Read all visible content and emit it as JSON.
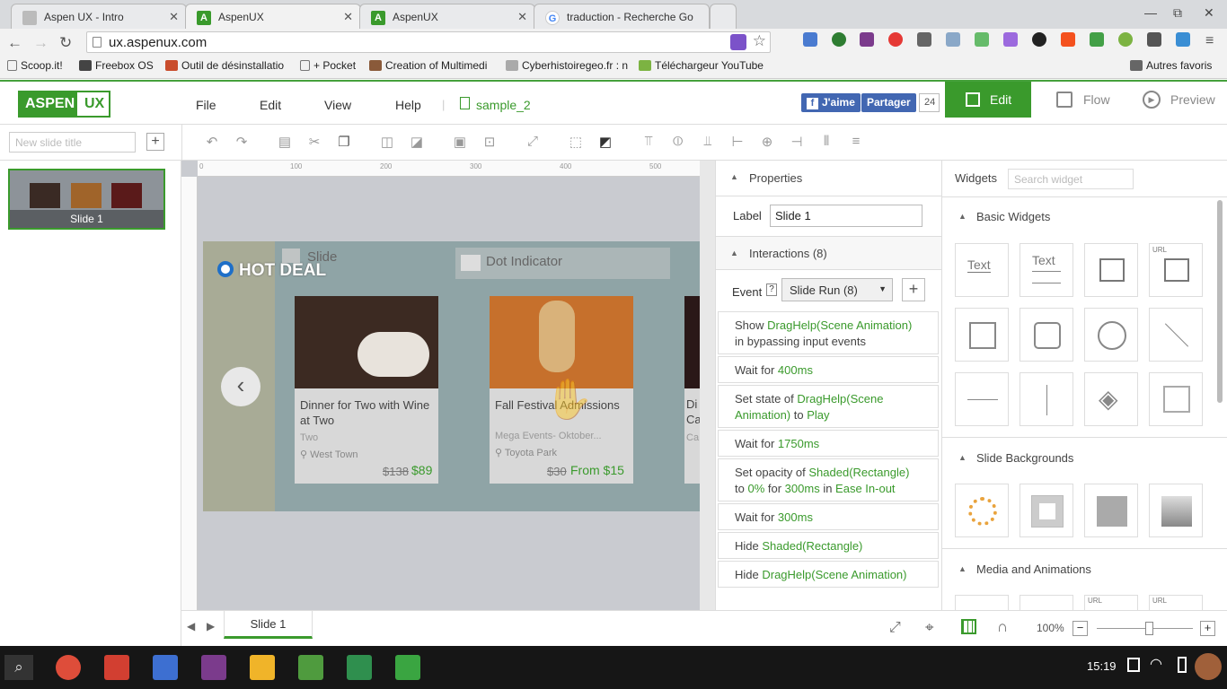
{
  "browser": {
    "tabs": [
      {
        "title": "Aspen UX - Intro",
        "active": false
      },
      {
        "title": "AspenUX",
        "active": true
      },
      {
        "title": "AspenUX",
        "active": false
      },
      {
        "title": "traduction - Recherche Go",
        "active": false
      }
    ],
    "url": "ux.aspenux.com",
    "bookmarks": [
      "Scoop.it!",
      "Freebox OS",
      "Outil de désinstallatio",
      "+ Pocket",
      "Creation of Multimedi",
      "Cyberhistoiregeo.fr : n",
      "Téléchargeur YouTube"
    ],
    "other_bookmarks": "Autres favoris"
  },
  "app": {
    "logo_left": "ASPEN",
    "logo_right": "UX",
    "menu": [
      "File",
      "Edit",
      "View",
      "Help"
    ],
    "file_name": "sample_2",
    "facebook": {
      "like": "J'aime",
      "share": "Partager",
      "count": "24"
    },
    "modes": {
      "edit": "Edit",
      "flow": "Flow",
      "preview": "Preview"
    }
  },
  "left": {
    "slide_title_placeholder": "New slide title",
    "thumb_label": "Slide 1"
  },
  "canvas": {
    "hot_deal": "HOT DEAL",
    "slide_label": "Slide",
    "dot_indicator": "Dot Indicator",
    "cards": [
      {
        "title": "Dinner for Two with Wine at Two",
        "subtitle": "Two",
        "location": "West Town",
        "old": "$138",
        "new": "$89"
      },
      {
        "title": "Fall Festival Admissions",
        "subtitle": "Mega Events- Oktober...",
        "location": "Toyota Park",
        "old": "$30",
        "new": "From $15"
      }
    ],
    "partial_card": [
      "Di",
      "Ca",
      "Ca"
    ]
  },
  "properties": {
    "header": "Properties",
    "label_caption": "Label",
    "label_value": "Slide 1",
    "interactions_header": "Interactions (8)",
    "event_caption": "Event",
    "event_value": "Slide Run (8)",
    "rows": [
      {
        "parts": [
          "Show ",
          "DragHelp(Scene Animation)",
          " in bypassing input events"
        ]
      },
      {
        "parts": [
          "Wait for ",
          "400ms",
          ""
        ]
      },
      {
        "parts": [
          "Set state of ",
          "DragHelp(Scene Animation)",
          " to ",
          "Play"
        ]
      },
      {
        "parts": [
          "Wait for ",
          "1750ms",
          ""
        ]
      },
      {
        "parts": [
          "Set opacity of ",
          "Shaded(Rectangle)",
          " to ",
          "0%",
          " for ",
          "300ms",
          " in ",
          "Ease In-out"
        ]
      },
      {
        "parts": [
          "Wait for ",
          "300ms",
          ""
        ]
      },
      {
        "parts": [
          "Hide ",
          "Shaded(Rectangle)",
          ""
        ]
      },
      {
        "parts": [
          "Hide ",
          "DragHelp(Scene Animation)",
          ""
        ]
      }
    ]
  },
  "widgets": {
    "header": "Widgets",
    "search_placeholder": "Search widget",
    "basic": "Basic Widgets",
    "text1": "Text",
    "text2": "Text",
    "url1": "URL",
    "backgrounds": "Slide Backgrounds",
    "media": "Media and Animations",
    "url2": "URL",
    "url3": "URL"
  },
  "bottom": {
    "slide_tab": "Slide 1",
    "zoom": "100%",
    "zoom_fraction": 0.5
  },
  "taskbar": {
    "time": "15:19"
  }
}
